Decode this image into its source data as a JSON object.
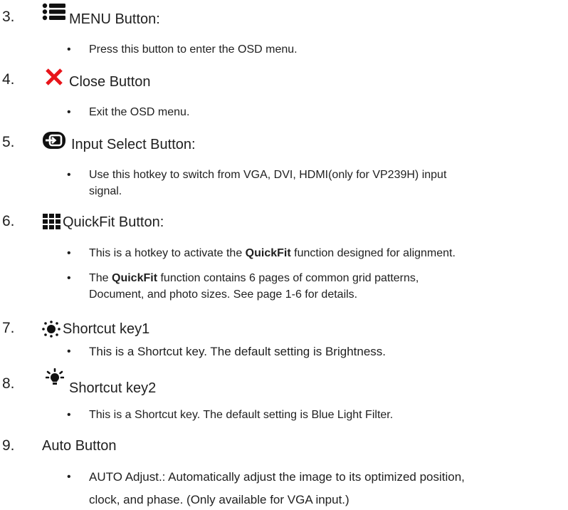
{
  "items": [
    {
      "number": "3.",
      "title": "MENU Button:",
      "icon": "menu-icon",
      "bullets": [
        {
          "text": "Press this button to enter the OSD menu."
        }
      ]
    },
    {
      "number": "4.",
      "title": "Close Button",
      "icon": "close-icon",
      "bullets": [
        {
          "text": "Exit the OSD menu."
        }
      ]
    },
    {
      "number": "5.",
      "title": "Input Select Button:",
      "icon": "input-select-icon",
      "bullets": [
        {
          "line1": "Use this hotkey to switch from VGA, DVI, HDMI(only for VP239H) input",
          "line2": "signal."
        }
      ]
    },
    {
      "number": "6.",
      "title": "QuickFit Button:",
      "icon": "quickfit-grid-icon",
      "bullets": [
        {
          "pre": "This is a hotkey to activate the ",
          "bold": "QuickFit",
          "post": " function designed for alignment."
        },
        {
          "pre": "The ",
          "bold": "QuickFit",
          "post": " function contains 6 pages of common grid patterns,",
          "line2": "Document, and photo sizes. See page 1-6 for details."
        }
      ]
    },
    {
      "number": "7.",
      "title": "Shortcut key1",
      "icon": "brightness-icon",
      "bullets": [
        {
          "text": "This is a Shortcut key. The default setting is Brightness."
        }
      ]
    },
    {
      "number": "8.",
      "title": "Shortcut key2",
      "icon": "blue-light-icon",
      "bullets": [
        {
          "text": "This is a Shortcut key. The default setting is Blue Light Filter."
        }
      ]
    },
    {
      "number": "9.",
      "title": "Auto Button",
      "icon": "",
      "bullets": [
        {
          "line1": "AUTO Adjust.: Automatically adjust the image to its optimized position,",
          "line2": "clock, and phase. (Only available for VGA input.)"
        }
      ]
    }
  ],
  "bullet_symbol": "•",
  "colors": {
    "text": "#1f1f1f",
    "close_icon": "#e8141a"
  }
}
